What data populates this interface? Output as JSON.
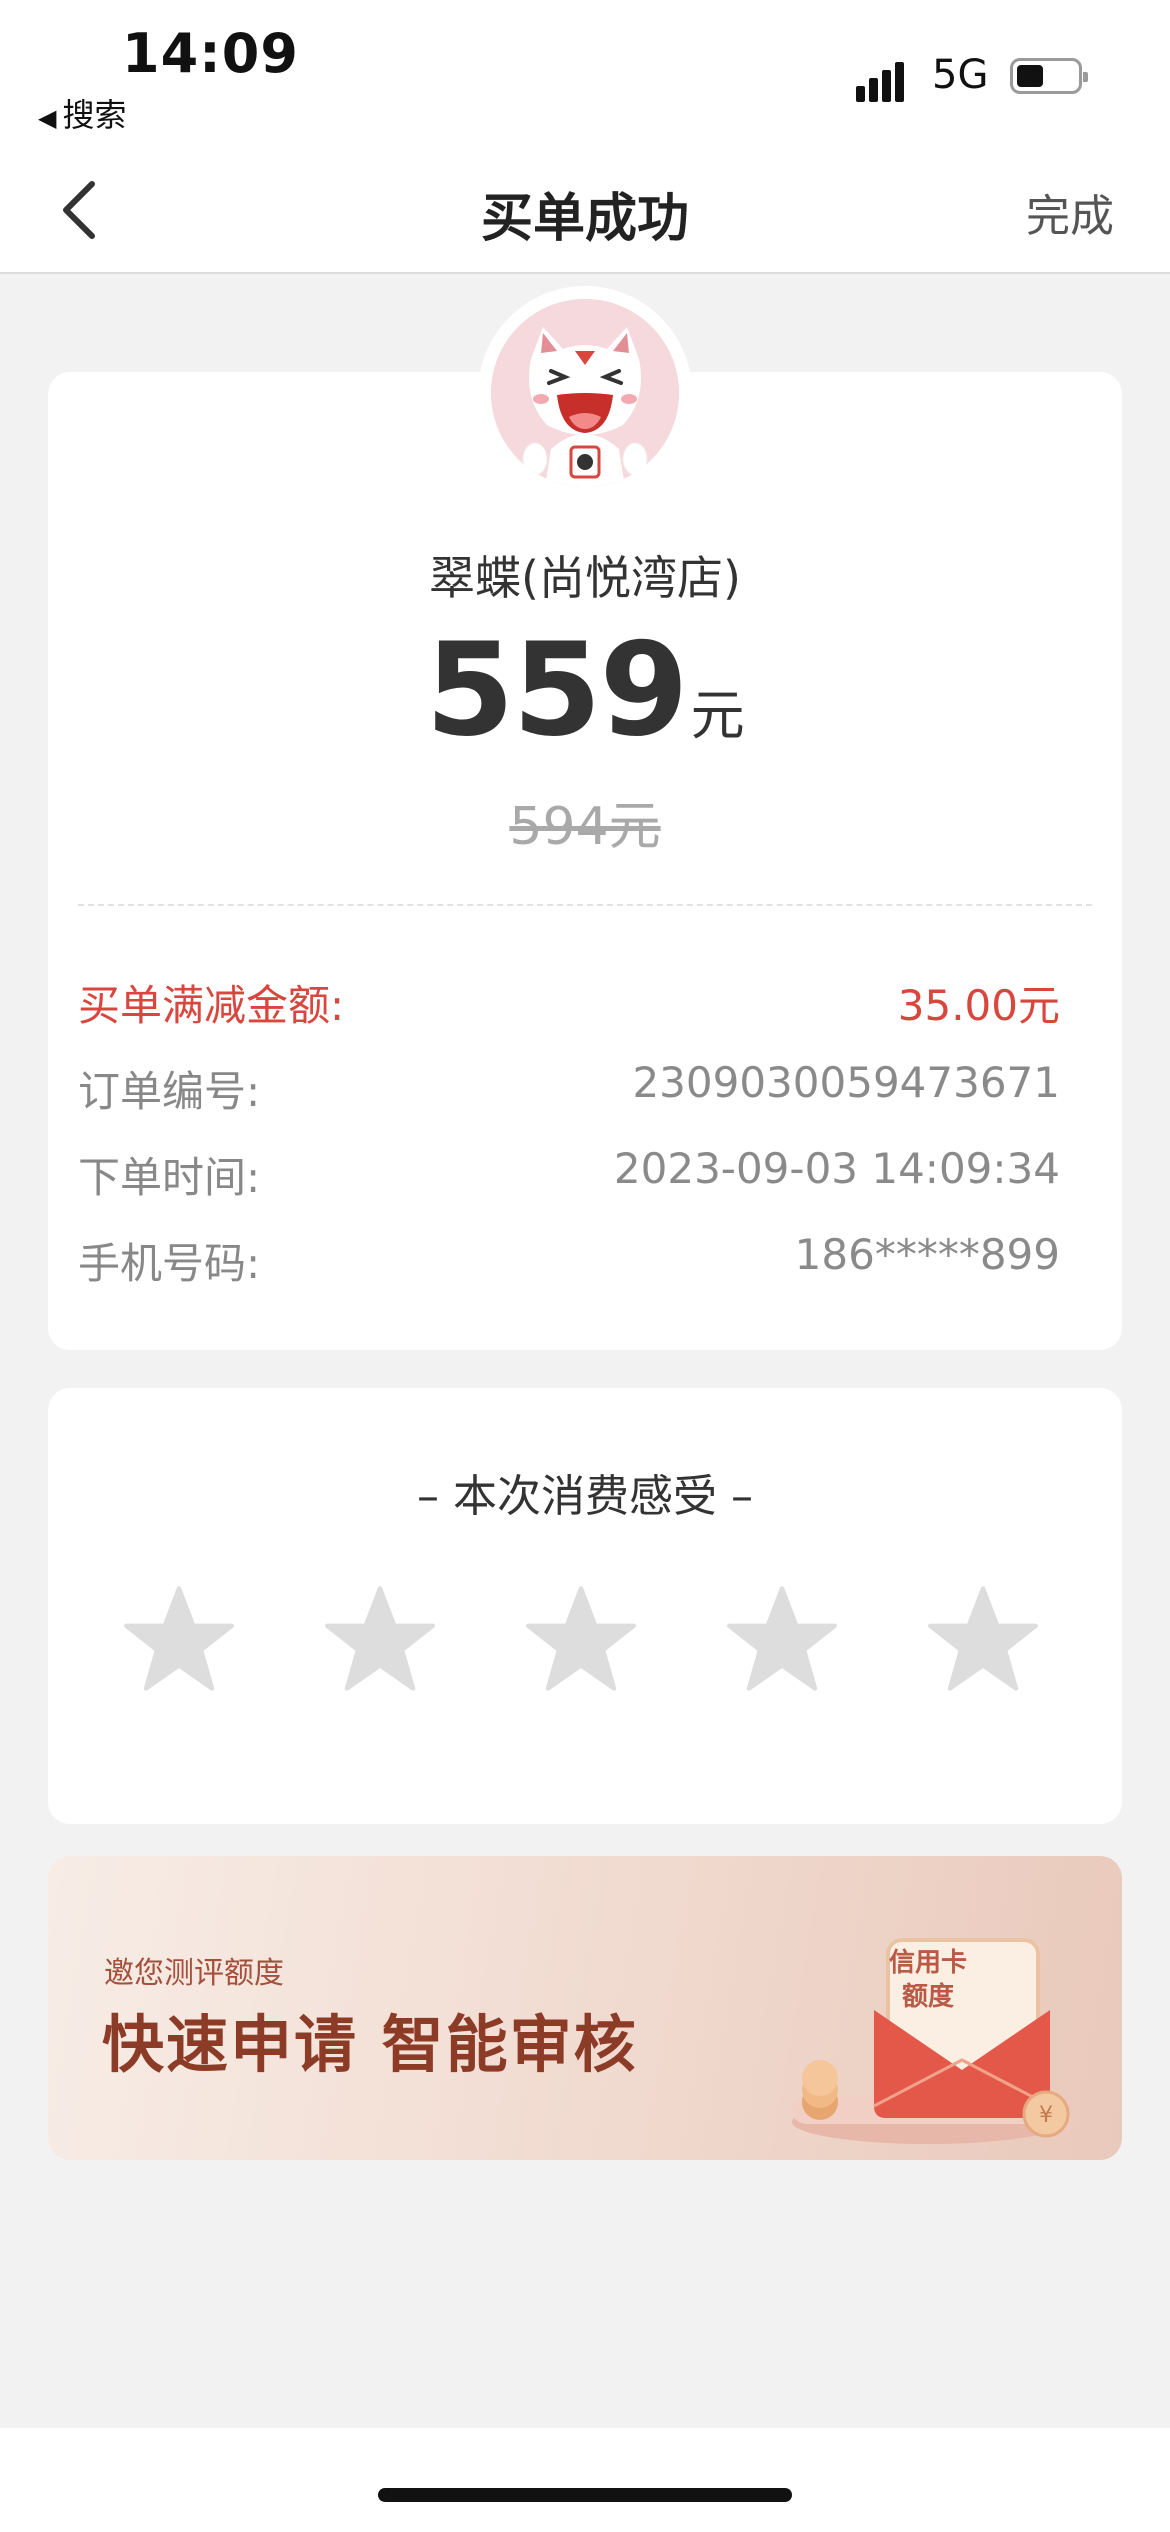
{
  "status_bar": {
    "time": "14:09",
    "back_app": "搜索",
    "network": "5G",
    "battery_level": 0.45
  },
  "nav": {
    "title": "买单成功",
    "done": "完成"
  },
  "receipt": {
    "merchant": "翠蝶(尚悦湾店)",
    "amount": "559",
    "amount_unit": "元",
    "original_amount": "594元",
    "rows": [
      {
        "key": "买单满减金额:",
        "value": "35.00元"
      },
      {
        "key": "订单编号:",
        "value": "2309030059473671"
      },
      {
        "key": "下单时间:",
        "value": "2023-09-03 14:09:34"
      },
      {
        "key": "手机号码:",
        "value": "186*****899"
      }
    ]
  },
  "rating": {
    "title": "– 本次消费感受 –",
    "stars": 5,
    "selected": 0
  },
  "banner": {
    "small_text": "邀您测评额度",
    "big_text": "快速申请 智能审核",
    "card_line1": "信用卡",
    "card_line2": "额度"
  },
  "colors": {
    "accent_red": "#d9463e",
    "star_gray": "#dddddd",
    "banner_brown": "#8c3b27"
  }
}
